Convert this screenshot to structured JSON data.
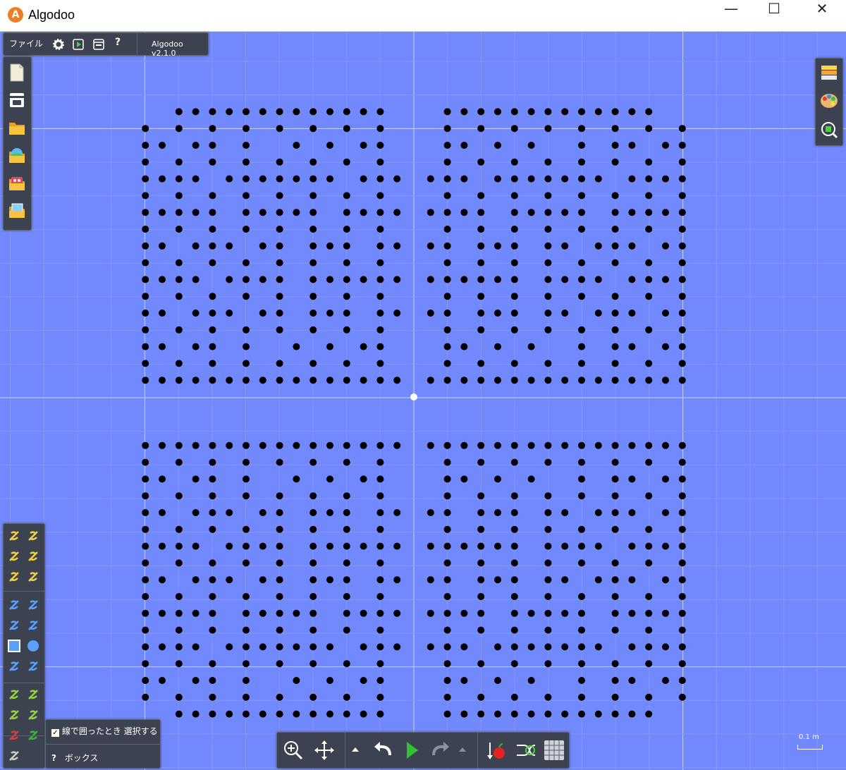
{
  "window": {
    "title": "Algodoo",
    "logo_letter": "A",
    "minimize_glyph": "—",
    "maximize_glyph": "☐",
    "close_glyph": "✕"
  },
  "topbar": {
    "file_label": "ファイル",
    "help_label": "?",
    "version": "Algodoo v2.1.0"
  },
  "left_menu_icons": [
    "new-scene-icon",
    "scene-browser-icon",
    "open-folder-icon",
    "open-landscape-icon",
    "open-algobox-icon",
    "open-image-icon"
  ],
  "right_menu_icons": [
    "layers-icon",
    "palette-icon",
    "zoom-to-fit-icon"
  ],
  "toolbox_icons": [
    "sketch-tool-icon",
    "knife-tool-icon",
    "move-tool-icon",
    "drag-tool-icon",
    "rotate-tool-icon",
    "scale-tool-icon",
    "rope-tool-icon",
    "pen-tool-icon",
    "hand-tool-icon",
    "gear-tool-icon",
    "box-tool-icon",
    "circle-tool-icon",
    "plane-tool-icon",
    "brush-tool-icon",
    "spring-tool-icon",
    "fixate-tool-icon",
    "axle-tool-icon",
    "tracer-tool-icon",
    "laser-tool-icon",
    "thruster-tool-icon",
    "chain-tool-icon"
  ],
  "tool_options": {
    "lasso_select_label": "線で囲ったとき 選択する",
    "lasso_select_checked": true,
    "help_glyph": "?",
    "current_tool_label": "ボックス"
  },
  "bottom_bar_icons": [
    "zoom-icon",
    "pan-icon",
    "undo-arrow-up-icon",
    "undo-icon",
    "play-icon",
    "redo-icon",
    "redo-arrow-up-icon",
    "gravity-icon",
    "air-friction-icon",
    "grid-icon"
  ],
  "scale": {
    "label": "0.1 m"
  },
  "colors": {
    "background": "#7289fd",
    "grid_minor": "#8497fd",
    "grid_major": "#c6cffe",
    "dots": "#000000",
    "panel": "#3c4250"
  },
  "pattern": {
    "quadrant_rows": [
      "..-------------.",
      "-.-.-.-.-.-.-.-.",
      "--.--.-..-.-.--.",
      "-.-.-.-.-.-.-.-.",
      "----.-------.---",
      "-.-.-.-.-.-.-.-.",
      "-----.-----.----",
      "-.-.-.-.-.-.-.-.",
      "--.---.--.---.--",
      "-.-.-.-.-.-.-.-.",
      "----.----.------",
      "-.-.-.-.-.-.-.-.",
      "--.---.--.---.--",
      "-.-.-.-.-.-.-.-.",
      "--.--.-..-.-.--.",
      "-.-.-.-.-.-.-.-.",
      "----------------"
    ]
  }
}
